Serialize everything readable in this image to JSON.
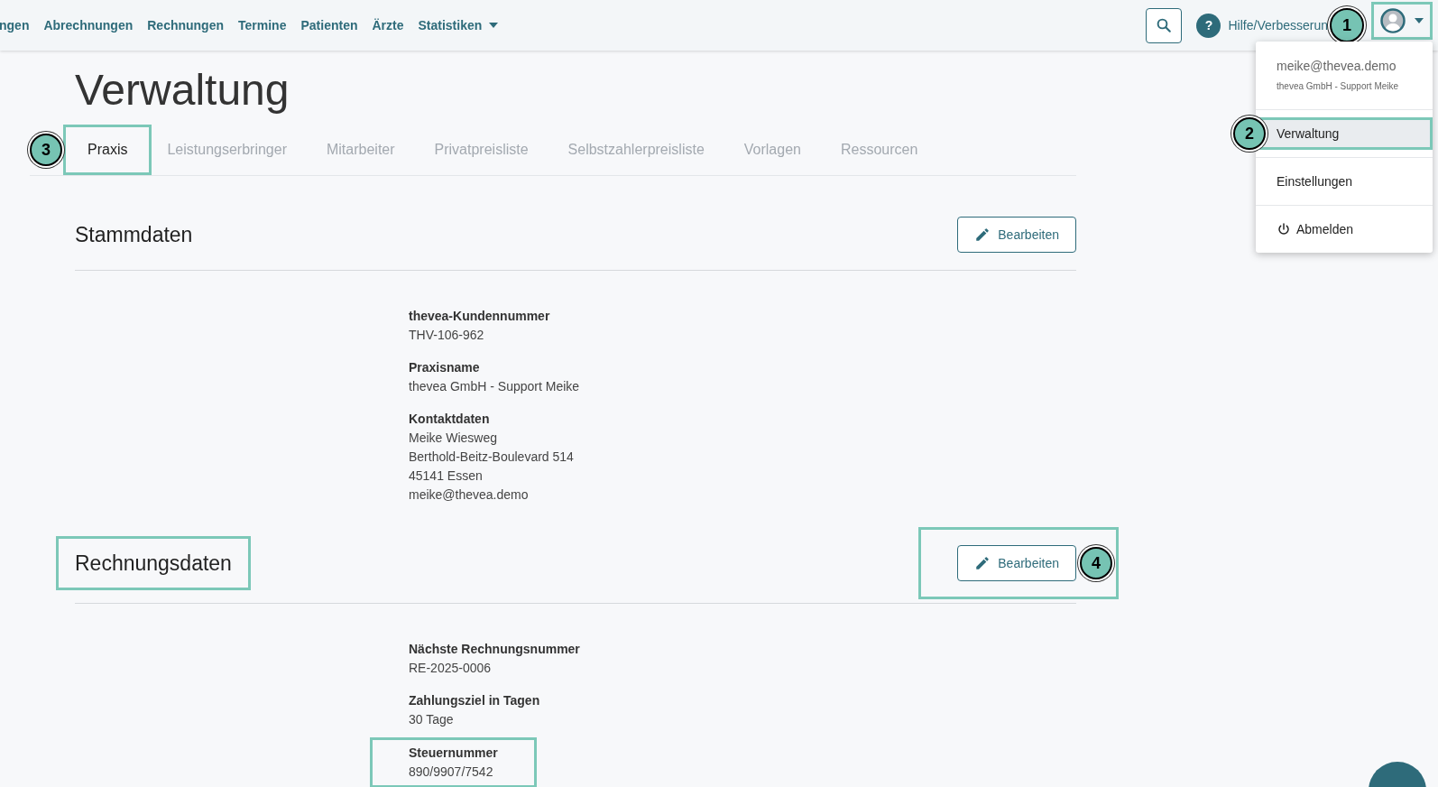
{
  "nav": {
    "items": [
      {
        "label": "ngen",
        "kind": "link"
      },
      {
        "label": "Abrechnungen",
        "kind": "link"
      },
      {
        "label": "Rechnungen",
        "kind": "link"
      },
      {
        "label": "Termine",
        "kind": "link"
      },
      {
        "label": "Patienten",
        "kind": "link"
      },
      {
        "label": "Ärzte",
        "kind": "link"
      },
      {
        "label": "Statistiken",
        "kind": "dropdown"
      }
    ],
    "help": {
      "icon": "?",
      "label": "Hilfe/Verbesserun"
    },
    "user_button": {
      "highlighted": true,
      "callout": "1"
    }
  },
  "user_menu": {
    "email": "meike@thevea.demo",
    "organization": "thevea GmbH - Support Meike",
    "items": [
      {
        "label": "Verwaltung",
        "kind": "plain",
        "selected": true,
        "highlighted": true,
        "callout": "2"
      },
      {
        "label": "Einstellungen",
        "kind": "plain",
        "selected": false,
        "highlighted": false
      },
      {
        "label": "Abmelden",
        "kind": "logout",
        "selected": false,
        "highlighted": false
      }
    ]
  },
  "title": "Verwaltung",
  "tabs": [
    {
      "label": "Praxis",
      "selected": true,
      "highlighted": true,
      "callout": "3"
    },
    {
      "label": "Leistungserbringer",
      "selected": false,
      "highlighted": false
    },
    {
      "label": "Mitarbeiter",
      "selected": false,
      "highlighted": false
    },
    {
      "label": "Privatpreisliste",
      "selected": false,
      "highlighted": false
    },
    {
      "label": "Selbstzahlerpreisliste",
      "selected": false,
      "highlighted": false
    },
    {
      "label": "Vorlagen",
      "selected": false,
      "highlighted": false
    },
    {
      "label": "Ressourcen",
      "selected": false,
      "highlighted": false
    }
  ],
  "sections": [
    {
      "title": {
        "text": "Stammdaten",
        "highlighted": false
      },
      "button": {
        "label": "Bearbeiten",
        "highlighted": false
      },
      "fields": [
        {
          "label": "thevea-Kundennummer",
          "lines": [
            "THV-106-962"
          ],
          "highlighted": false
        },
        {
          "label": "Praxisname",
          "lines": [
            "thevea GmbH - Support Meike"
          ],
          "highlighted": false
        },
        {
          "label": "Kontaktdaten",
          "lines": [
            "Meike Wiesweg",
            "Berthold-Beitz-Boulevard 514",
            "45141 Essen",
            "meike@thevea.demo"
          ],
          "highlighted": false
        }
      ]
    },
    {
      "title": {
        "text": "Rechnungsdaten",
        "highlighted": true
      },
      "button": {
        "label": "Bearbeiten",
        "highlighted": true,
        "callout": "4"
      },
      "fields": [
        {
          "label": "Nächste Rechnungsnummer",
          "lines": [
            "RE-2025-0006"
          ],
          "highlighted": false
        },
        {
          "label": "Zahlungsziel in Tagen",
          "lines": [
            "30 Tage"
          ],
          "highlighted": false
        },
        {
          "label": "Steuernummer",
          "lines": [
            "890/9907/7542"
          ],
          "highlighted": true
        }
      ]
    }
  ]
}
